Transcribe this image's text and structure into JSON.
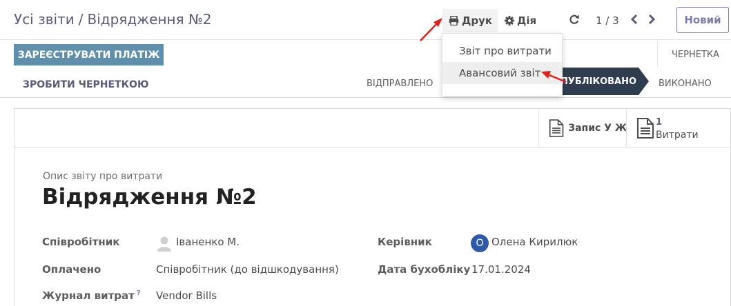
{
  "breadcrumb": {
    "parent": "Усі звіти",
    "separator": "/",
    "current": "Відрядження №2"
  },
  "toolbar": {
    "print_label": "Друк",
    "action_label": "Дія"
  },
  "pager": {
    "value": "1 / 3"
  },
  "new_button": "Новий",
  "dropdown": {
    "items": [
      "Звіт про витрати",
      "Авансовий звіт"
    ]
  },
  "header_buttons": {
    "register_payment": "ЗАРЕЄСТРУВАТИ ПЛАТІЖ",
    "reset_to_draft": "ЗРОБИТИ ЧЕРНЕТКОЮ"
  },
  "statusbar": {
    "draft": "ЧЕРНЕТКА",
    "submitted": "ВІДПРАВЛЕНО",
    "posted": "ПУБЛІКОВАНО",
    "done": "ВИКОНАНО"
  },
  "smart_buttons": {
    "journal_entry": "Запис У Ж",
    "expenses_count": "1",
    "expenses_label": "Витрати"
  },
  "form": {
    "subtitle": "Опис звіту про витрати",
    "title": "Відрядження №2",
    "fields": {
      "employee_label": "Співробітник",
      "employee_value": "Іваненко М.",
      "paid_by_label": "Оплачено",
      "paid_by_value": "Співробітник (до відшкодування)",
      "journal_label": "Журнал витрат",
      "journal_help": "?",
      "journal_value": "Vendor Bills",
      "manager_label": "Керівник",
      "manager_initial": "О",
      "manager_value": "Олена Кирилюк",
      "accounting_date_label": "Дата бухобліку",
      "accounting_date_value": "17.01.2024"
    }
  },
  "colors": {
    "primary": "#7c7bad",
    "register_button": "#5f8faa",
    "active_stage": "#2f3d4e",
    "manager_avatar": "#2f5aa8",
    "annotation_arrow": "#e0201b"
  },
  "icons": [
    "print-icon",
    "gear-icon",
    "reload-icon",
    "chevron-left-icon",
    "chevron-right-icon",
    "document-icon",
    "user-avatar-icon"
  ]
}
